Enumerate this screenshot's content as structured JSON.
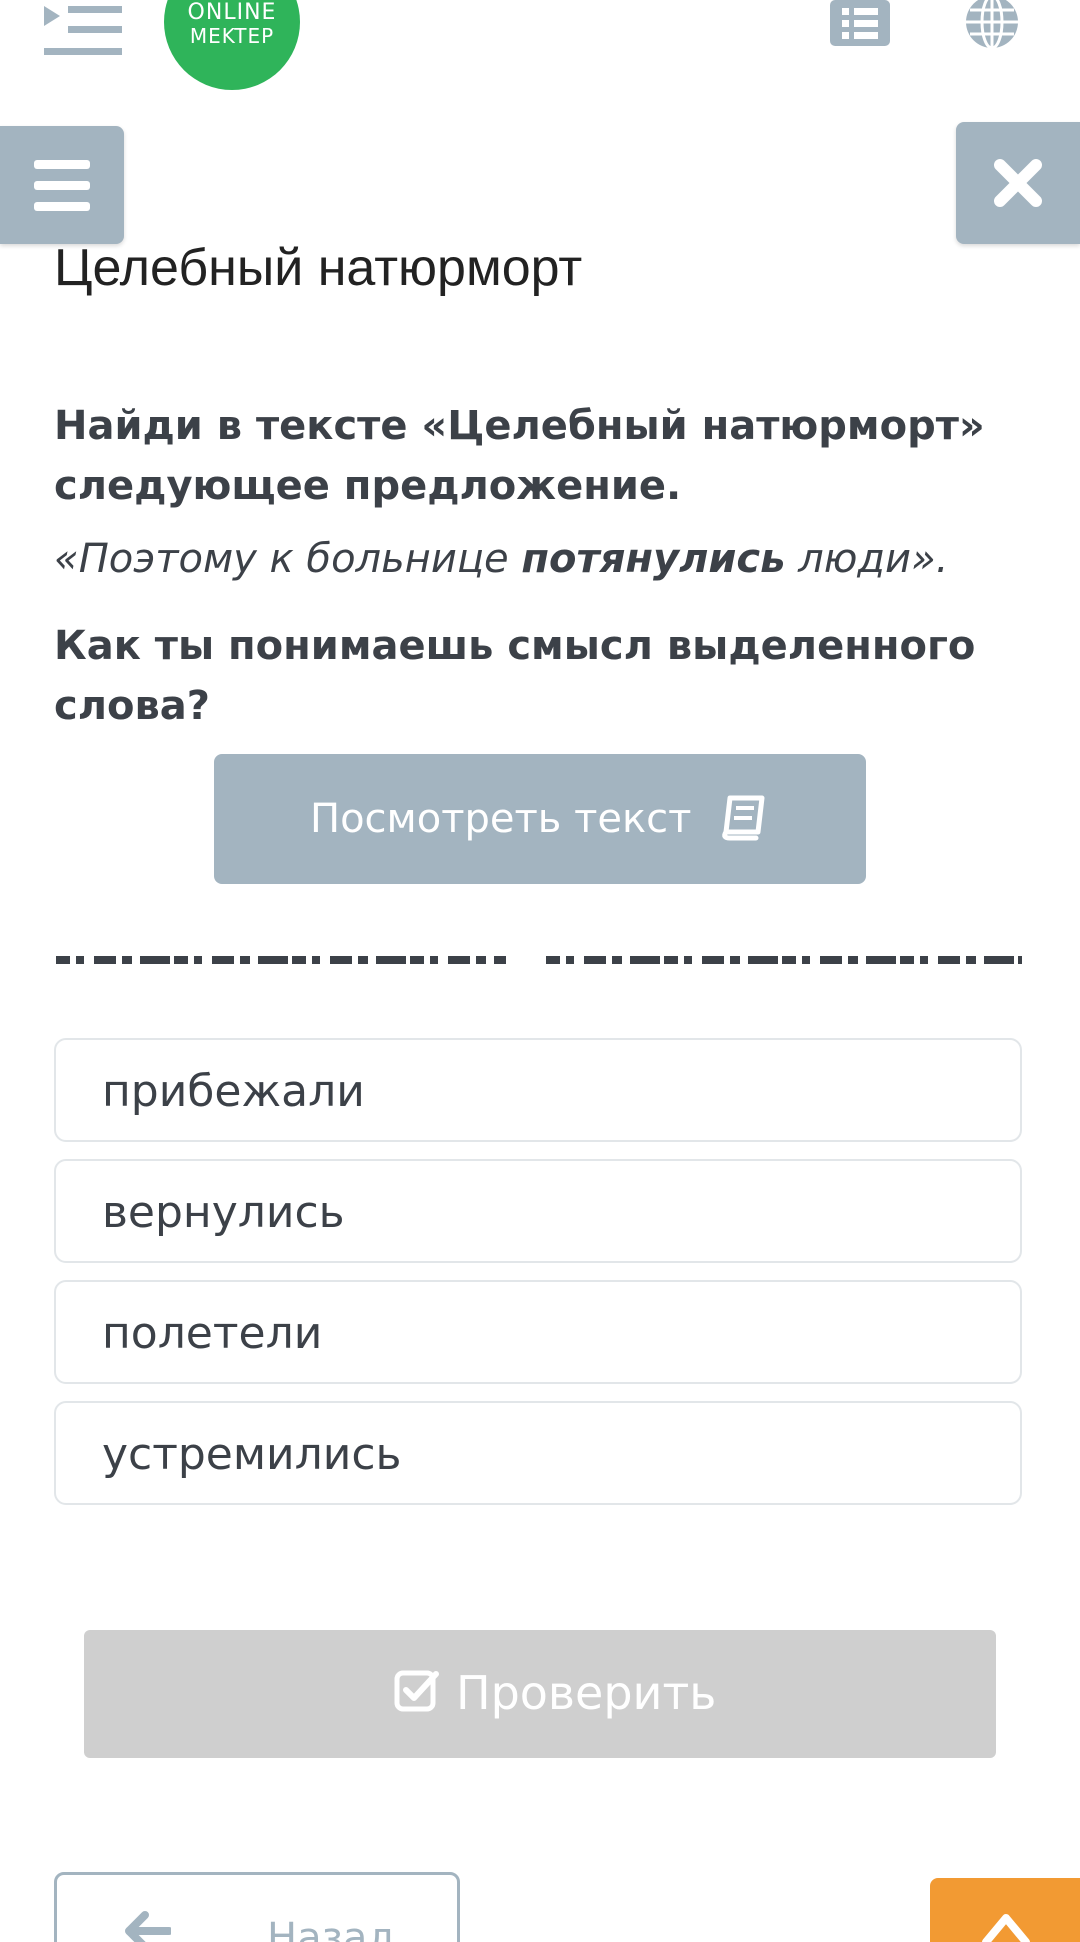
{
  "header": {
    "logo_line1": "ONLINE",
    "logo_line2": "MEKTEP"
  },
  "title": "Целебный натюрморт",
  "question": {
    "prompt": "Найди в тексте «Целебный натюрморт» следующее предложение.",
    "quote_before": "«Поэтому к больнице ",
    "quote_highlight": "потянулись",
    "quote_after": " люди».",
    "prompt2": "Как ты понимаешь смысл выделенного слова?"
  },
  "view_text_button": {
    "label": "Посмотреть текст"
  },
  "options": [
    {
      "label": "прибежали"
    },
    {
      "label": "вернулись"
    },
    {
      "label": "полетели"
    },
    {
      "label": "устремились"
    }
  ],
  "check_button": {
    "label": "Проверить"
  },
  "back_button": {
    "label": "Назад"
  },
  "colors": {
    "accent_gray_blue": "#a3b4c0",
    "logo_green": "#2fb45a",
    "disabled_gray": "#cfcfcf",
    "orange": "#f29a33"
  }
}
